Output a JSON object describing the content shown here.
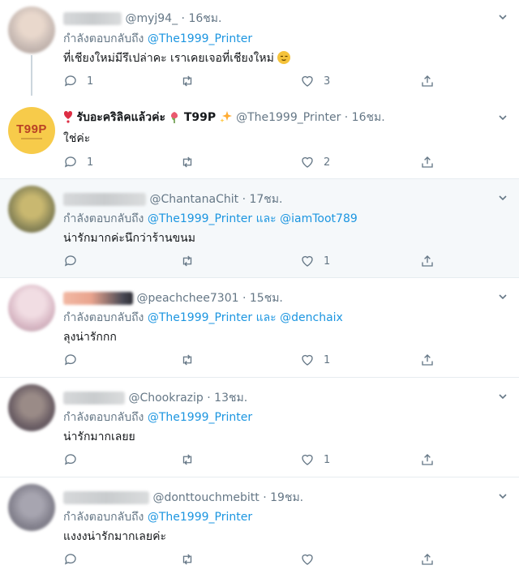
{
  "reply_prefix": "กำลังตอบกลับถึง",
  "and_word": "และ",
  "tweets": [
    {
      "handle": "@myj94_",
      "time": "· 16ชม.",
      "reply_to": "@The1999_Printer",
      "text": "ที่เชียงใหม่มีรึเปล่าคะ เราเคยเจอที่เชียงใหม่",
      "replies": "1",
      "retweets": "",
      "likes": "3"
    },
    {
      "display_name": "รับอะคริลิคแล้วค่ะ",
      "name_suffix": "T99P",
      "avatar_text": "T99P",
      "handle": "@The1999_Printer",
      "time": "· 16ชม.",
      "text": "ใช่ค่ะ",
      "replies": "1",
      "retweets": "",
      "likes": "2"
    },
    {
      "handle": "@ChantanaChit",
      "time": "· 17ชม.",
      "reply_to": "@The1999_Printer",
      "reply_to_2": "@iamToot789",
      "text": "น่ารักมากค่ะนึกว่าร้านขนม",
      "replies": "",
      "retweets": "",
      "likes": "1"
    },
    {
      "handle": "@peachchee7301",
      "time": "· 15ชม.",
      "reply_to": "@The1999_Printer",
      "reply_to_2": "@denchaix",
      "text": "ลุงน่ารักกก",
      "replies": "",
      "retweets": "",
      "likes": "1"
    },
    {
      "handle": "@Chookrazip",
      "time": "· 13ชม.",
      "reply_to": "@The1999_Printer",
      "text": "น่ารักมากเลยย",
      "replies": "",
      "retweets": "",
      "likes": "1"
    },
    {
      "handle": "@donttouchmebitt",
      "time": "· 19ชม.",
      "reply_to": "@The1999_Printer",
      "text": "แงงงน่ารักมากเลยค่ะ",
      "replies": "",
      "retweets": "",
      "likes": ""
    }
  ],
  "colors": {
    "link": "#1b95e0",
    "secondary": "#657786",
    "border": "#e6ecf0",
    "highlight_bg": "#f5f8fa"
  },
  "icons": {
    "reply": "reply-icon",
    "retweet": "retweet-icon",
    "like": "heart-icon",
    "share": "share-icon",
    "menu": "chevron-down-icon"
  }
}
